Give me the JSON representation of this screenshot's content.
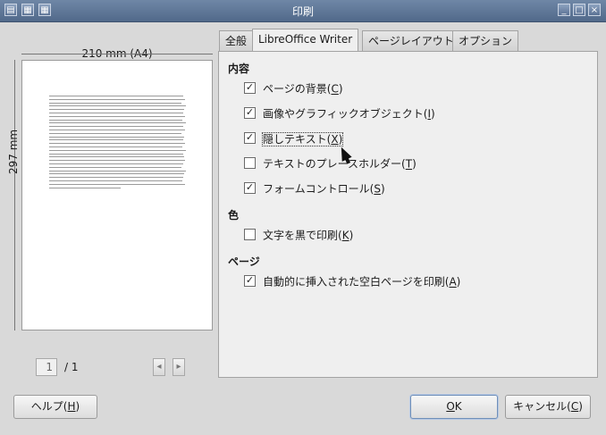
{
  "window": {
    "title": "印刷",
    "buttons": [
      "▤",
      "▦",
      "_",
      "□",
      "×"
    ]
  },
  "preview": {
    "width_label": "210 mm (A4)",
    "height_label": "297 mm",
    "current_page": "1",
    "page_total": "/ 1",
    "prev_label": "◂",
    "next_label": "▸"
  },
  "tabs": [
    "全般",
    "LibreOffice Writer",
    "ページレイアウト",
    "オプション"
  ],
  "sections": {
    "contents": "内容",
    "color": "色",
    "pages": "ページ"
  },
  "options": {
    "background": {
      "label": "ページの背景",
      "key": "C",
      "checked": true
    },
    "graphics": {
      "label": "画像やグラフィックオブジェクト",
      "key": "I",
      "checked": true
    },
    "hidden_text": {
      "label": "隠しテキスト",
      "key": "X",
      "checked": true
    },
    "placeholder": {
      "label": "テキストのプレースホルダー",
      "key": "T",
      "checked": false
    },
    "form_controls": {
      "label": "フォームコントロール",
      "key": "S",
      "checked": true
    },
    "black_text": {
      "label": "文字を黒で印刷",
      "key": "K",
      "checked": false
    },
    "auto_blank": {
      "label": "自動的に挿入された空白ページを印刷",
      "key": "A",
      "checked": true
    }
  },
  "footer": {
    "help": {
      "label": "ヘルプ",
      "key": "H"
    },
    "ok": {
      "label": "OK",
      "key": "O"
    },
    "cancel": {
      "label": "キャンセル",
      "key": "C"
    }
  }
}
